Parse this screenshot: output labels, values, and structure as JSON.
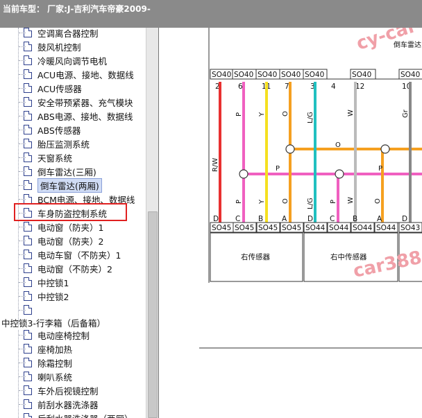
{
  "titlebar": {
    "title": "当前车型： 厂家:J-吉利汽车帝豪2009-"
  },
  "tree": {
    "items": [
      {
        "label": "空调离合器控制"
      },
      {
        "label": "鼓风机控制"
      },
      {
        "label": "冷暖风向调节电机"
      },
      {
        "label": "ACU电源、接地、数据线"
      },
      {
        "label": "ACU传感器"
      },
      {
        "label": "安全带预紧器、充气模块"
      },
      {
        "label": "ABS电源、接地、数据线"
      },
      {
        "label": "ABS传感器"
      },
      {
        "label": "胎压监测系统"
      },
      {
        "label": "天窗系统"
      },
      {
        "label": "倒车雷达(三厢)"
      },
      {
        "label": "倒车雷达(两厢)"
      },
      {
        "label": "BCM电源、接地、数据线"
      },
      {
        "label": "车身防盗控制系统"
      },
      {
        "label": "电动窗（防夹）1"
      },
      {
        "label": "电动窗（防夹）2"
      },
      {
        "label": "电动车窗（不防夹）1"
      },
      {
        "label": "电动窗（不防夹）2"
      },
      {
        "label": "中控锁1"
      },
      {
        "label": "中控锁2"
      },
      {
        "label": ""
      }
    ],
    "folder": {
      "label": "中控锁3-行李箱（后备箱）"
    },
    "sub_items": [
      {
        "label": "电动座椅控制"
      },
      {
        "label": "座椅加热"
      },
      {
        "label": "除霜控制"
      },
      {
        "label": "喇叭系统"
      },
      {
        "label": "车外后视镜控制"
      },
      {
        "label": "前刮水器洗涤器"
      },
      {
        "label": "后刮水器洗涤器（两厢）"
      }
    ]
  },
  "diagram": {
    "watermark_top": "cy-car",
    "watermark_bottom": "car388",
    "top_component": "倒车雷达",
    "top_connectors": [
      "SO40",
      "SO40",
      "SO40",
      "SO40",
      "SO40",
      "SO40",
      "SO40"
    ],
    "pins_top": [
      "2",
      "6",
      "11",
      "7",
      "3",
      "4",
      "12",
      "10"
    ],
    "wires": [
      {
        "label": "R/W",
        "color": "#e83030"
      },
      {
        "label": "P",
        "color": "#f060c0"
      },
      {
        "label": "Y",
        "color": "#f5e020"
      },
      {
        "label": "O",
        "color": "#f5a020"
      },
      {
        "label": "L/G",
        "color": "#20c0c0"
      },
      {
        "label": "P",
        "color": "#f060c0"
      },
      {
        "label": "W",
        "color": "#bbbbbb"
      },
      {
        "label": "O",
        "color": "#f5a020"
      },
      {
        "label": "Gr",
        "color": "#888888"
      }
    ],
    "bus_labels": {
      "o": "O",
      "p": "P"
    },
    "pins_bottom": [
      "D",
      "C",
      "B",
      "A",
      "D",
      "C",
      "B",
      "A",
      "D"
    ],
    "bottom_connectors": [
      "SO45",
      "SO45",
      "SO45",
      "SO45",
      "SO44",
      "SO44",
      "SO44",
      "SO44",
      "SO43"
    ],
    "sensor_left": "右传感器",
    "sensor_middle": "右中传感器"
  }
}
